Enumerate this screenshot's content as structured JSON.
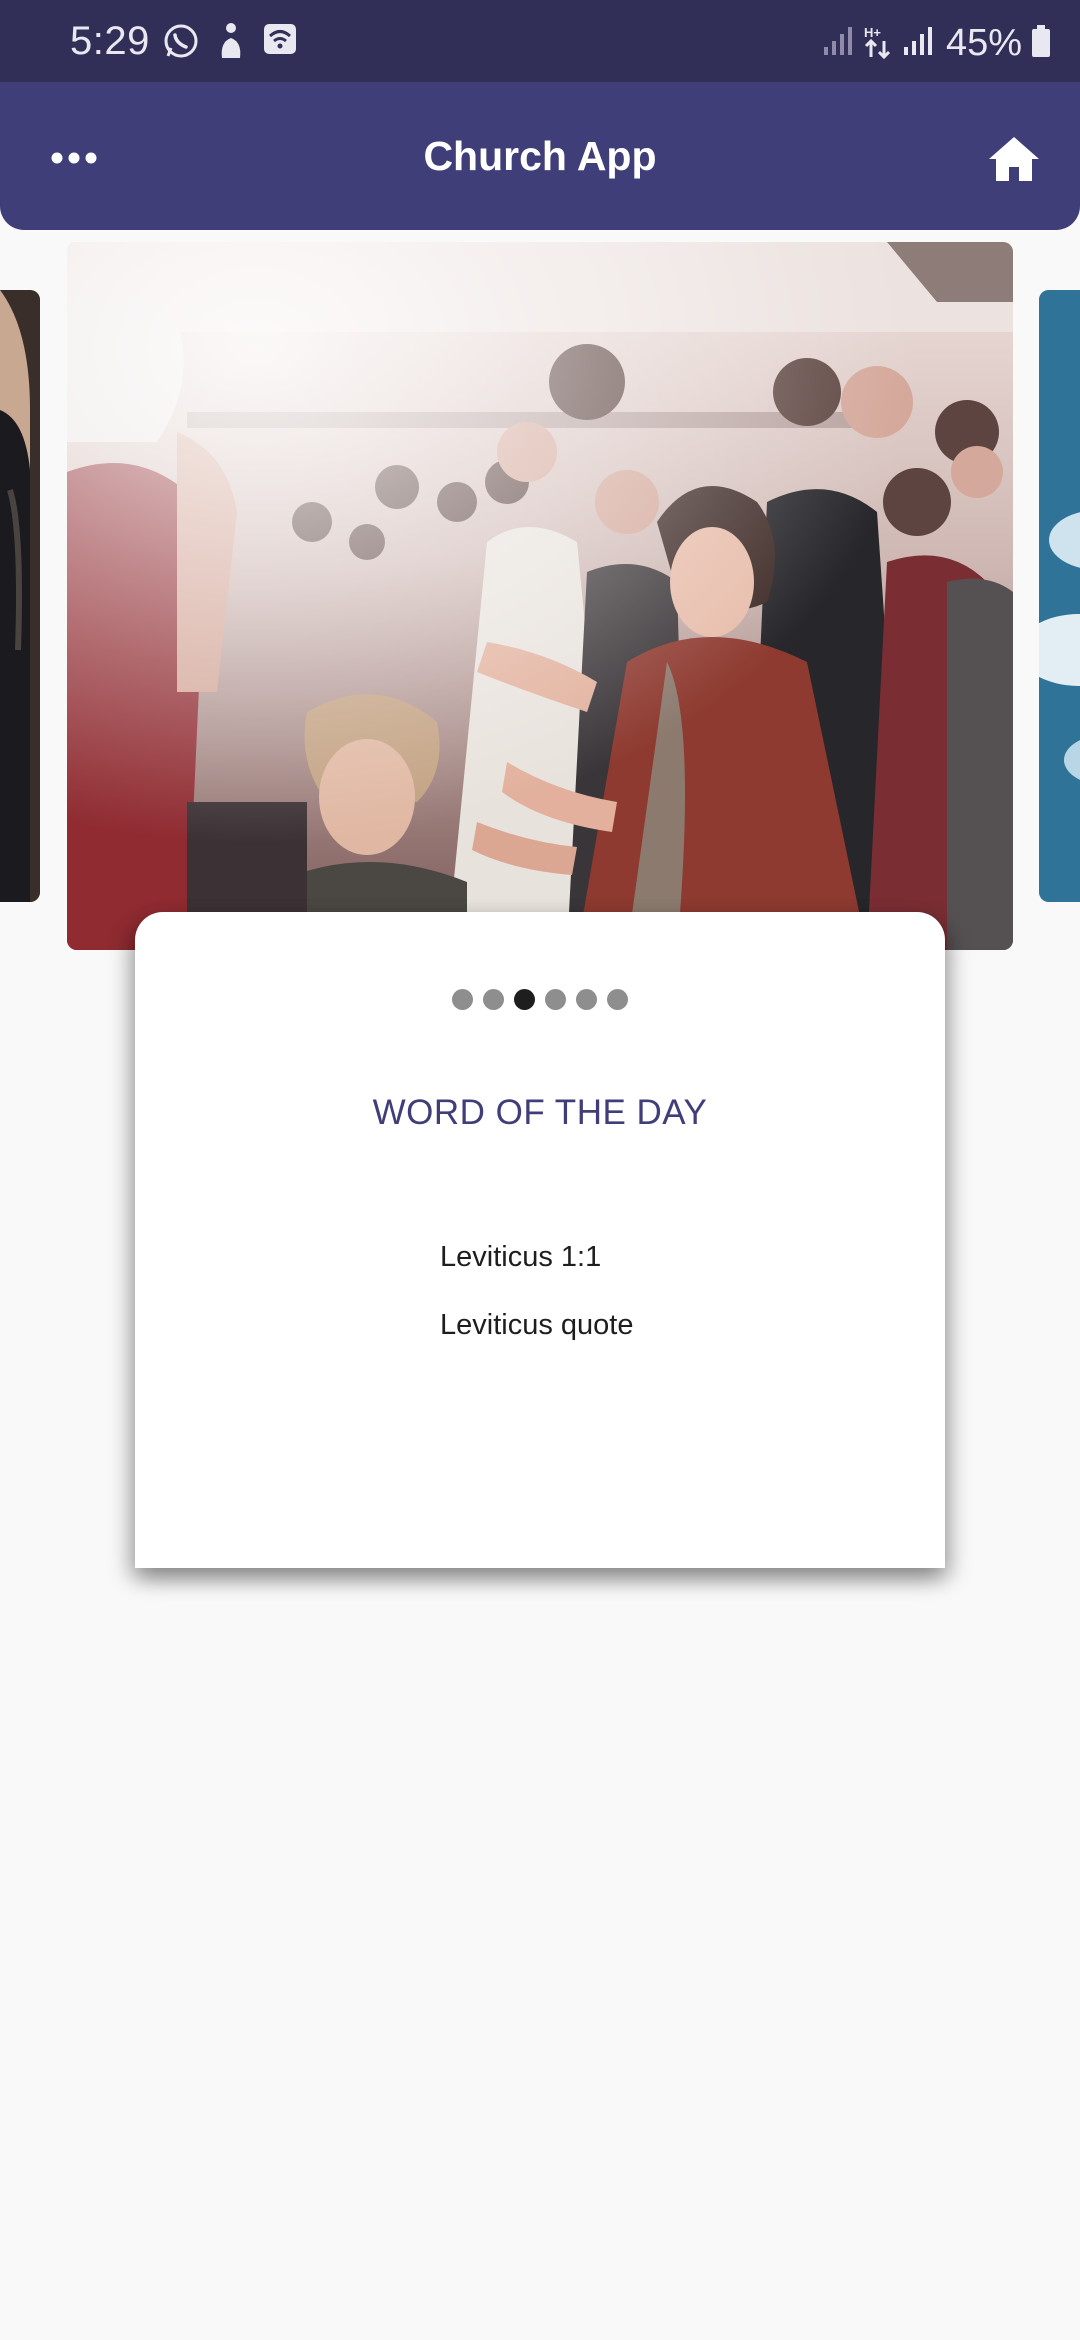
{
  "status_bar": {
    "time": "5:29",
    "battery": "45%",
    "left_icons": [
      "whatsapp-icon",
      "accessibility-icon",
      "wifi-hotspot-icon"
    ],
    "right_icons": [
      "signal-icon",
      "data-arrows-icon",
      "signal-icon",
      "battery-icon"
    ]
  },
  "app_bar": {
    "title": "Church App",
    "menu_icon": "more-horizontal-icon",
    "home_icon": "home-icon"
  },
  "carousel": {
    "slides": [
      "previous-slide",
      "congregation-worship-photo",
      "next-slide-sky"
    ],
    "active_index": 2,
    "dot_count": 6
  },
  "card": {
    "heading": "WORD OF THE DAY",
    "verse_ref": "Leviticus 1:1",
    "verse_text": "Leviticus quote"
  },
  "colors": {
    "status_bar": "#312f57",
    "app_bar": "#403e79",
    "heading": "#403e79",
    "background": "#f9f9f9",
    "dot_inactive": "#8e8e8e",
    "dot_active": "#1e1e1e"
  }
}
